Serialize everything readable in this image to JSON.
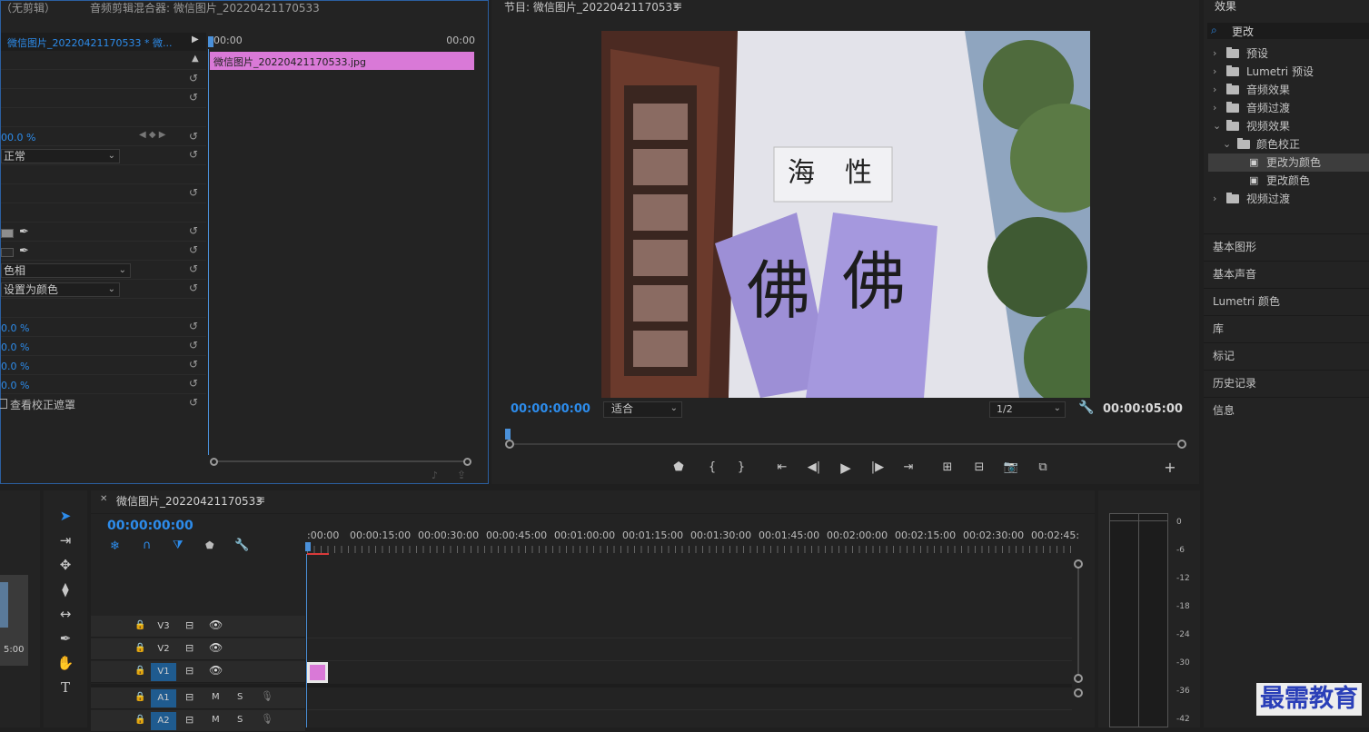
{
  "effect_controls": {
    "tab_no_clip": "（无剪辑）",
    "tab_mixer": "音频剪辑混合器: 微信图片_20220421170533",
    "clip_selector": "微信图片_20220421170533 * 微...",
    "time_start": "00:00",
    "time_end": "00:00",
    "clip_bar_label": "微信图片_20220421170533.jpg",
    "opacity_value": "00.0 %",
    "blend_mode": "正常",
    "change_by": "色相",
    "change_type": "设置为颜色",
    "tolerance": "0.0 %",
    "softness": "0.0 %",
    "hue_tolerance": "0.0 %",
    "saturation": "0.0 %",
    "view_mask_label": "查看校正遮罩"
  },
  "program_monitor": {
    "title": "节目: 微信图片_20220421170533",
    "timecode": "00:00:00:00",
    "fit_option": "适合",
    "resolution": "1/2",
    "duration": "00:00:05:00"
  },
  "effects_panel": {
    "title": "效果",
    "search_value": "更改",
    "items": [
      {
        "label": "预设",
        "level": 0,
        "expanded": false,
        "kind": "preset"
      },
      {
        "label": "Lumetri 预设",
        "level": 0,
        "expanded": false,
        "kind": "preset"
      },
      {
        "label": "音频效果",
        "level": 0,
        "expanded": false,
        "kind": "folder"
      },
      {
        "label": "音频过渡",
        "level": 0,
        "expanded": false,
        "kind": "folder"
      },
      {
        "label": "视频效果",
        "level": 0,
        "expanded": true,
        "kind": "folder"
      },
      {
        "label": "颜色校正",
        "level": 1,
        "expanded": true,
        "kind": "folder"
      },
      {
        "label": "更改为颜色",
        "level": 2,
        "kind": "effect",
        "selected": true
      },
      {
        "label": "更改颜色",
        "level": 2,
        "kind": "effect"
      },
      {
        "label": "视频过渡",
        "level": 0,
        "expanded": false,
        "kind": "folder"
      }
    ],
    "sections": [
      "基本图形",
      "基本声音",
      "Lumetri 颜色",
      "库",
      "标记",
      "历史记录",
      "信息"
    ]
  },
  "timeline": {
    "title": "微信图片_20220421170533",
    "timecode": "00:00:00:00",
    "ruler": [
      ":00:00",
      "00:00:15:00",
      "00:00:30:00",
      "00:00:45:00",
      "00:01:00:00",
      "00:01:15:00",
      "00:01:30:00",
      "00:01:45:00",
      "00:02:00:00",
      "00:02:15:00",
      "00:02:30:00",
      "00:02:45:"
    ],
    "video_tracks": [
      "V3",
      "V2",
      "V1"
    ],
    "audio_tracks": [
      "A1",
      "A2"
    ],
    "mute_label": "M",
    "solo_label": "S"
  },
  "project_bin": {
    "thumb_duration": "5:00"
  },
  "audio_meter": {
    "scale": [
      "0",
      "-6",
      "-12",
      "-18",
      "-24",
      "-30",
      "-36",
      "-42"
    ]
  },
  "watermark": "最需教育",
  "colors": {
    "accent": "#2d8ceb",
    "clip": "#d979d7",
    "playhead": "#4a90d9"
  }
}
